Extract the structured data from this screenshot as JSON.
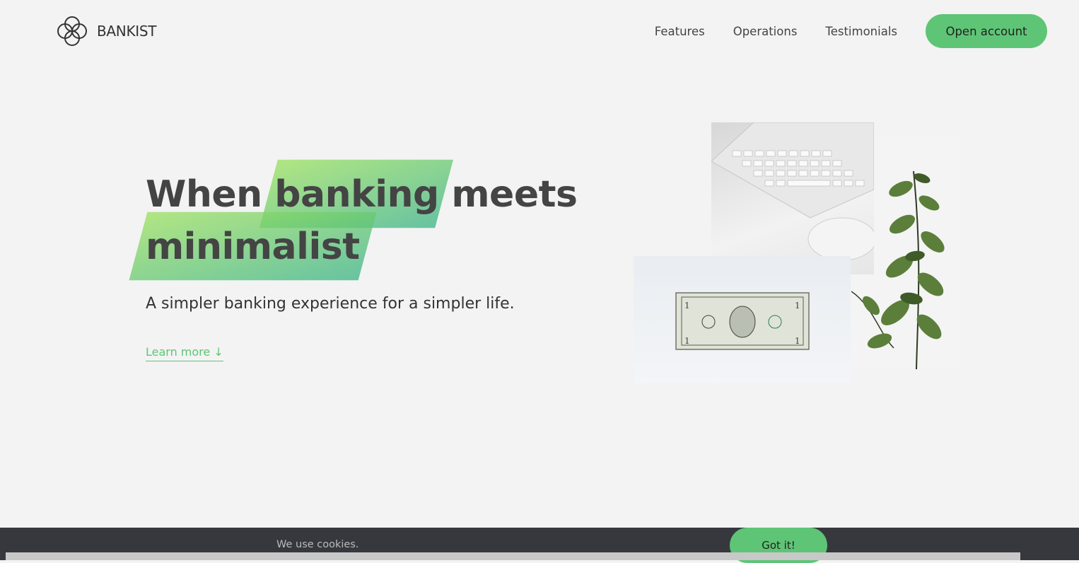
{
  "logo": {
    "text": "BANKIST",
    "icon": "four-circles-logo-icon"
  },
  "nav": {
    "links": [
      "Features",
      "Operations",
      "Testimonials"
    ],
    "cta": "Open account"
  },
  "hero": {
    "title_part1": "When",
    "title_highlight1": "banking",
    "title_part2": "meets",
    "title_highlight2": "minimalist",
    "subtitle": "A simpler banking experience for a simpler life.",
    "learn_more": "Learn more ↓"
  },
  "cookie": {
    "text": "We use cookies.",
    "button": "Got it!"
  },
  "colors": {
    "accent": "#5ec576",
    "background": "#f3f3f3",
    "cookie_bg": "#37383d",
    "highlight_from": "#9be15d",
    "highlight_to": "#39b385"
  }
}
